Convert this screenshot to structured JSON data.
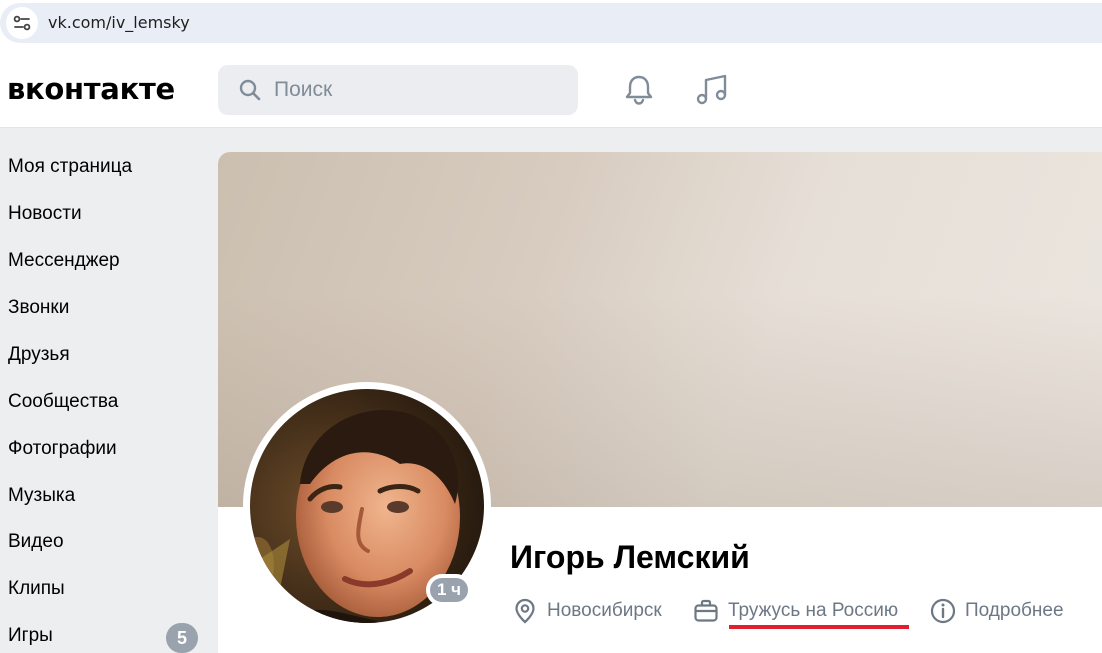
{
  "browser": {
    "url": "vk.com/iv_lemsky"
  },
  "header": {
    "logo": "вконтакте",
    "search_placeholder": "Поиск",
    "icons": [
      "bell-icon",
      "music-icon"
    ]
  },
  "sidebar": {
    "items": [
      {
        "label": "Моя страница"
      },
      {
        "label": "Новости"
      },
      {
        "label": "Мессенджер"
      },
      {
        "label": "Звонки"
      },
      {
        "label": "Друзья"
      },
      {
        "label": "Сообщества"
      },
      {
        "label": "Фотографии"
      },
      {
        "label": "Музыка"
      },
      {
        "label": "Видео"
      },
      {
        "label": "Клипы"
      },
      {
        "label": "Игры",
        "badge": "5"
      }
    ]
  },
  "profile": {
    "name": "Игорь Лемский",
    "online_status": "1 ч",
    "city": "Новосибирск",
    "work": "Тружусь на Россию",
    "details_link": "Подробнее",
    "accent_color": "#e0202e"
  }
}
